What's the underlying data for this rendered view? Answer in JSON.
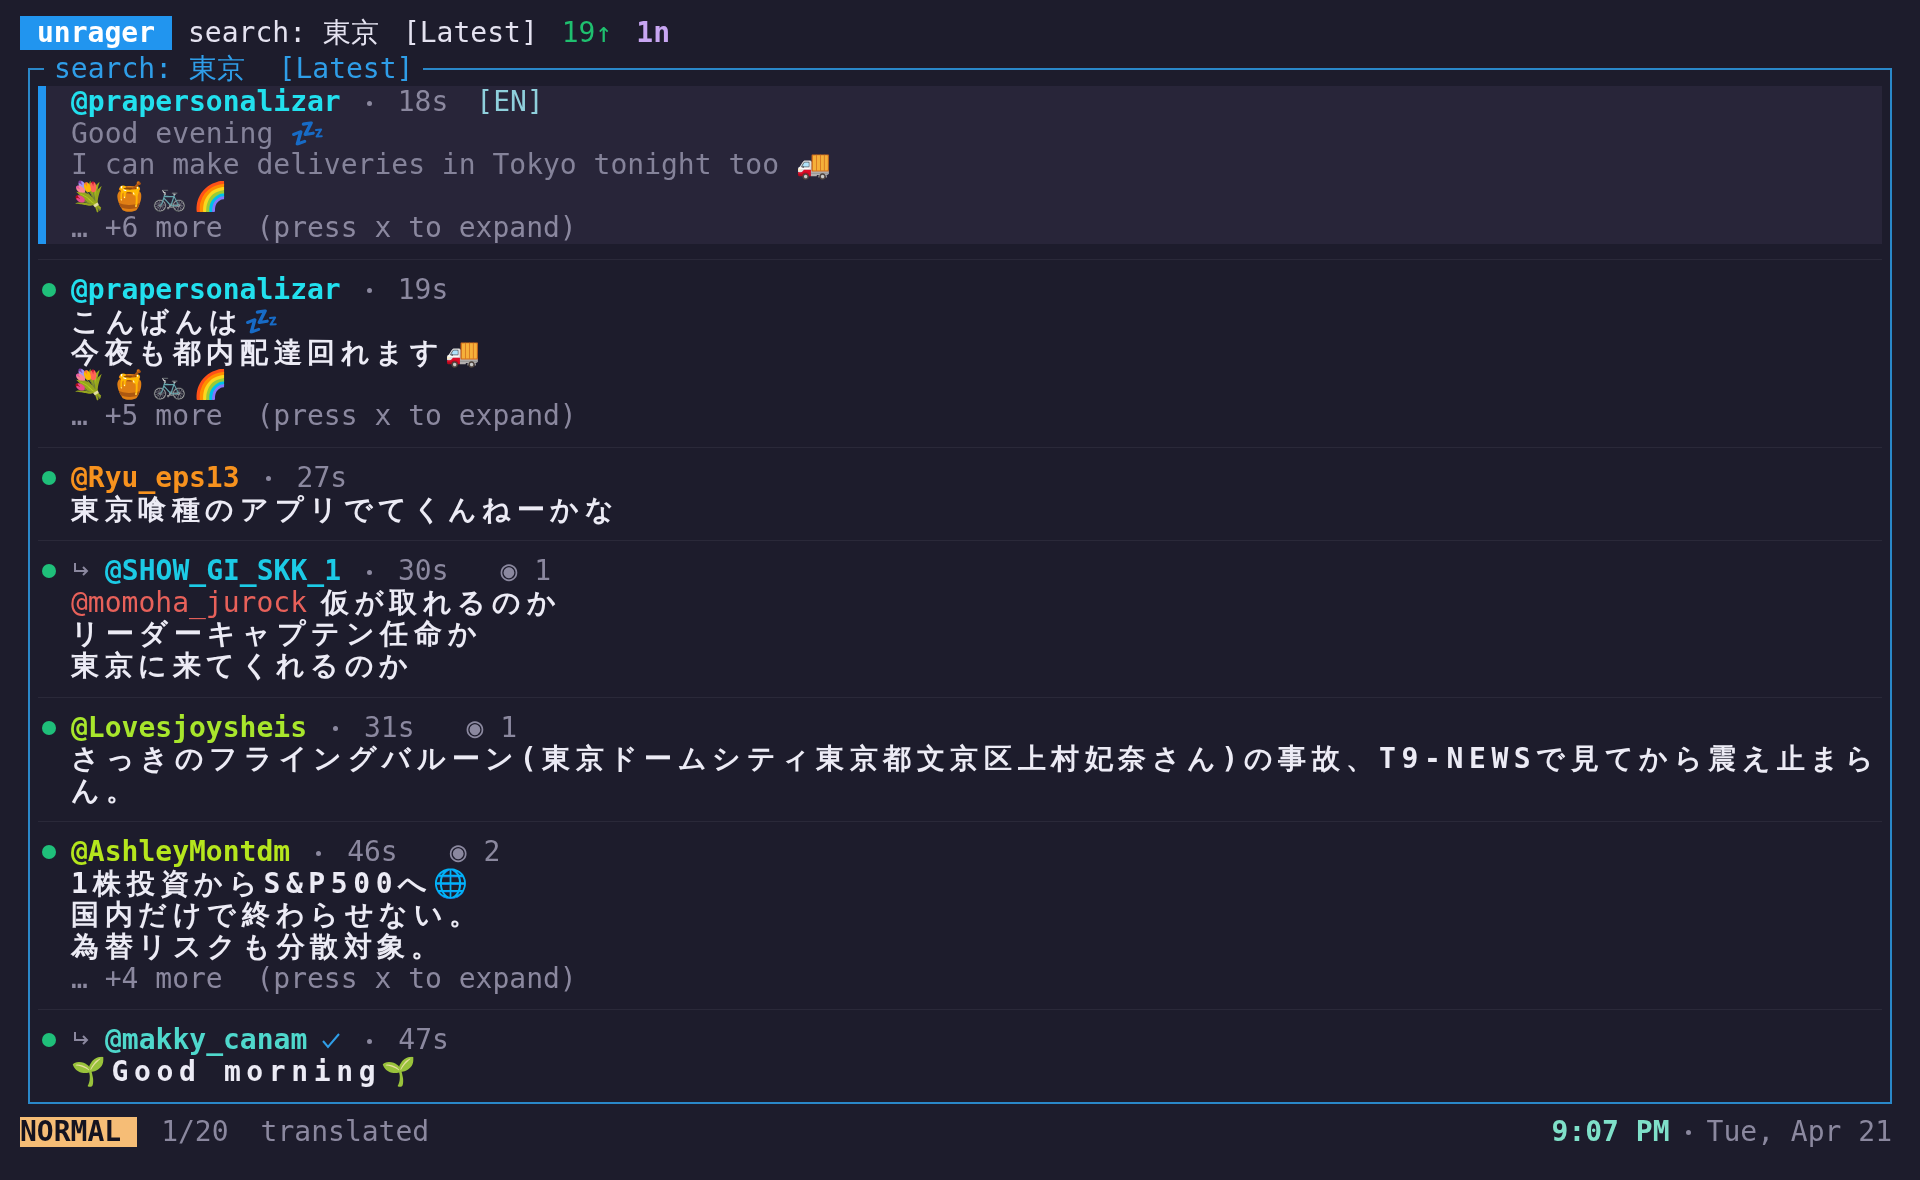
{
  "header": {
    "app": "unrager",
    "query": "search: 東京",
    "sort": "[Latest]",
    "new_count": "19↑",
    "pending": "1n"
  },
  "panel": {
    "title": "search: 東京  [Latest]"
  },
  "posts": [
    {
      "author": "@prapersonalizar",
      "color": "#22e0ee",
      "selected": true,
      "retweet": false,
      "verified": false,
      "time": "18s",
      "lang": "[EN]",
      "lines": [
        {
          "kind": "translated",
          "text": "Good evening 💤"
        },
        {
          "kind": "translated",
          "text": "I can make deliveries in Tokyo tonight too 🚚"
        },
        {
          "kind": "text",
          "text": "💐🍯🚲🌈"
        },
        {
          "kind": "more",
          "text": "… +6 more  (press x to expand)"
        }
      ]
    },
    {
      "author": "@prapersonalizar",
      "color": "#22e0ee",
      "selected": false,
      "retweet": false,
      "verified": false,
      "time": "19s",
      "lines": [
        {
          "kind": "text",
          "text": "こんばんは💤"
        },
        {
          "kind": "text",
          "text": "今夜も都内配達回れます🚚"
        },
        {
          "kind": "text",
          "text": "💐🍯🚲🌈"
        },
        {
          "kind": "more",
          "text": "… +5 more  (press x to expand)"
        }
      ]
    },
    {
      "author": "@Ryu_eps13",
      "color": "#f7921e",
      "selected": false,
      "retweet": false,
      "verified": false,
      "time": "27s",
      "lines": [
        {
          "kind": "text",
          "text": "東京喰種のアプリでてくんねーかな"
        }
      ]
    },
    {
      "author": "@SHOW_GI_SKK_1",
      "color": "#1ccbe6",
      "selected": false,
      "retweet": true,
      "verified": false,
      "time": "30s",
      "views": "◉ 1",
      "lines": [
        {
          "kind": "text",
          "mention": "@momoha_jurock",
          "text": "仮が取れるのか"
        },
        {
          "kind": "text",
          "text": "リーダーキャプテン任命か"
        },
        {
          "kind": "text",
          "text": "東京に来てくれるのか"
        }
      ]
    },
    {
      "author": "@Lovesjoysheis",
      "color": "#a8e62c",
      "selected": false,
      "retweet": false,
      "verified": false,
      "time": "31s",
      "views": "◉ 1",
      "lines": [
        {
          "kind": "text",
          "text": "さっきのフライングバルーン(東京ドームシティ東京都文京区上村妃奈さん)の事故、T9-NEWSで見てから震え止まらん。"
        }
      ]
    },
    {
      "author": "@AshleyMontdm",
      "color": "#b5e61d",
      "selected": false,
      "retweet": false,
      "verified": false,
      "time": "46s",
      "views": "◉ 2",
      "lines": [
        {
          "kind": "text",
          "text": "1株投資からS&P500へ🌐"
        },
        {
          "kind": "text",
          "text": "国内だけで終わらせない。"
        },
        {
          "kind": "text",
          "text": "為替リスクも分散対象。"
        },
        {
          "kind": "more",
          "text": "… +4 more  (press x to expand)"
        }
      ]
    },
    {
      "author": "@makky_canam",
      "color": "#4fd8cc",
      "selected": false,
      "retweet": true,
      "verified": true,
      "time": "47s",
      "lines": [
        {
          "kind": "text",
          "text": "🌱Good morning🌱"
        }
      ]
    }
  ],
  "status_bar": {
    "mode": "NORMAL",
    "position": "1/20",
    "flag": "translated",
    "time": "9:07 PM",
    "date": "Tue, Apr 21"
  }
}
